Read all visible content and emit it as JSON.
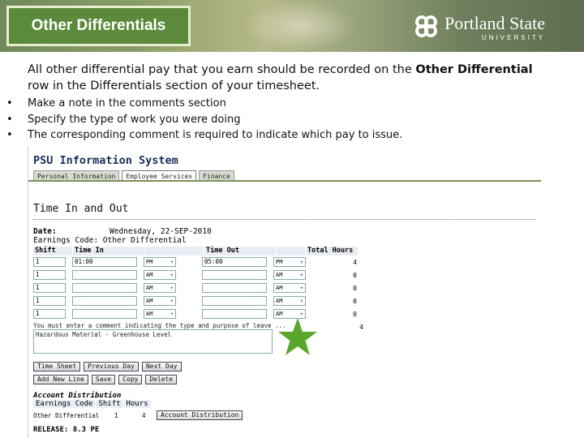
{
  "header": {
    "title": "Other Differentials",
    "logo_name": "Portland State",
    "logo_sub": "UNIVERSITY"
  },
  "intro": {
    "text_before": "All other differential pay that you earn should be recorded on the ",
    "text_bold": "Other Differential",
    "text_after": " row in the Differentials section of your timesheet."
  },
  "bullets": [
    "Make a note in the comments section",
    "Specify the type of work you were doing",
    "The corresponding comment is required to indicate which pay to issue."
  ],
  "screenshot": {
    "system_title": "PSU Information System",
    "tabs": [
      {
        "label": "Personal Information",
        "active": false
      },
      {
        "label": "Employee Services",
        "active": true
      },
      {
        "label": "Finance",
        "active": false
      }
    ],
    "page_heading": "Time In and Out",
    "date_label": "Date:",
    "date_value": "Wednesday, 22-SEP-2010",
    "earnings_code": "Earnings Code: Other Differential",
    "columns": [
      "Shift",
      "Time In",
      "",
      "Time Out",
      "",
      "Total Hours"
    ],
    "rows": [
      {
        "shift": "1",
        "time_in": "01:00",
        "in_ampm": "PM",
        "time_out": "05:00",
        "out_ampm": "PM",
        "total": "4"
      },
      {
        "shift": "1",
        "time_in": "",
        "in_ampm": "AM",
        "time_out": "",
        "out_ampm": "AM",
        "total": "0"
      },
      {
        "shift": "1",
        "time_in": "",
        "in_ampm": "AM",
        "time_out": "",
        "out_ampm": "AM",
        "total": "0"
      },
      {
        "shift": "1",
        "time_in": "",
        "in_ampm": "AM",
        "time_out": "",
        "out_ampm": "AM",
        "total": "0"
      },
      {
        "shift": "1",
        "time_in": "",
        "in_ampm": "AM",
        "time_out": "",
        "out_ampm": "AM",
        "total": "0"
      }
    ],
    "grand_total": "4",
    "comment_label": "You must enter a comment indicating the type and purpose of leave ...",
    "comment_value": "Hazardous Material - Greenhouse Level",
    "buttons_row1": [
      "Time Sheet",
      "Previous Day",
      "Next Day"
    ],
    "buttons_row2": [
      "Add New Line",
      "Save",
      "Copy",
      "Delete"
    ],
    "account_distribution_label": "Account Distribution",
    "acct_headers": [
      "Earnings Code",
      "Shift",
      "Hours"
    ],
    "acct_row": {
      "code": "Other Differential",
      "shift": "1",
      "hours": "4"
    },
    "acct_button": "Account Distribution",
    "release": "RELEASE: 8.3 PE",
    "colors": {
      "title_box": "#5a8a3a",
      "star": "#5aa62a",
      "header_text": "#1a2d5a"
    }
  }
}
